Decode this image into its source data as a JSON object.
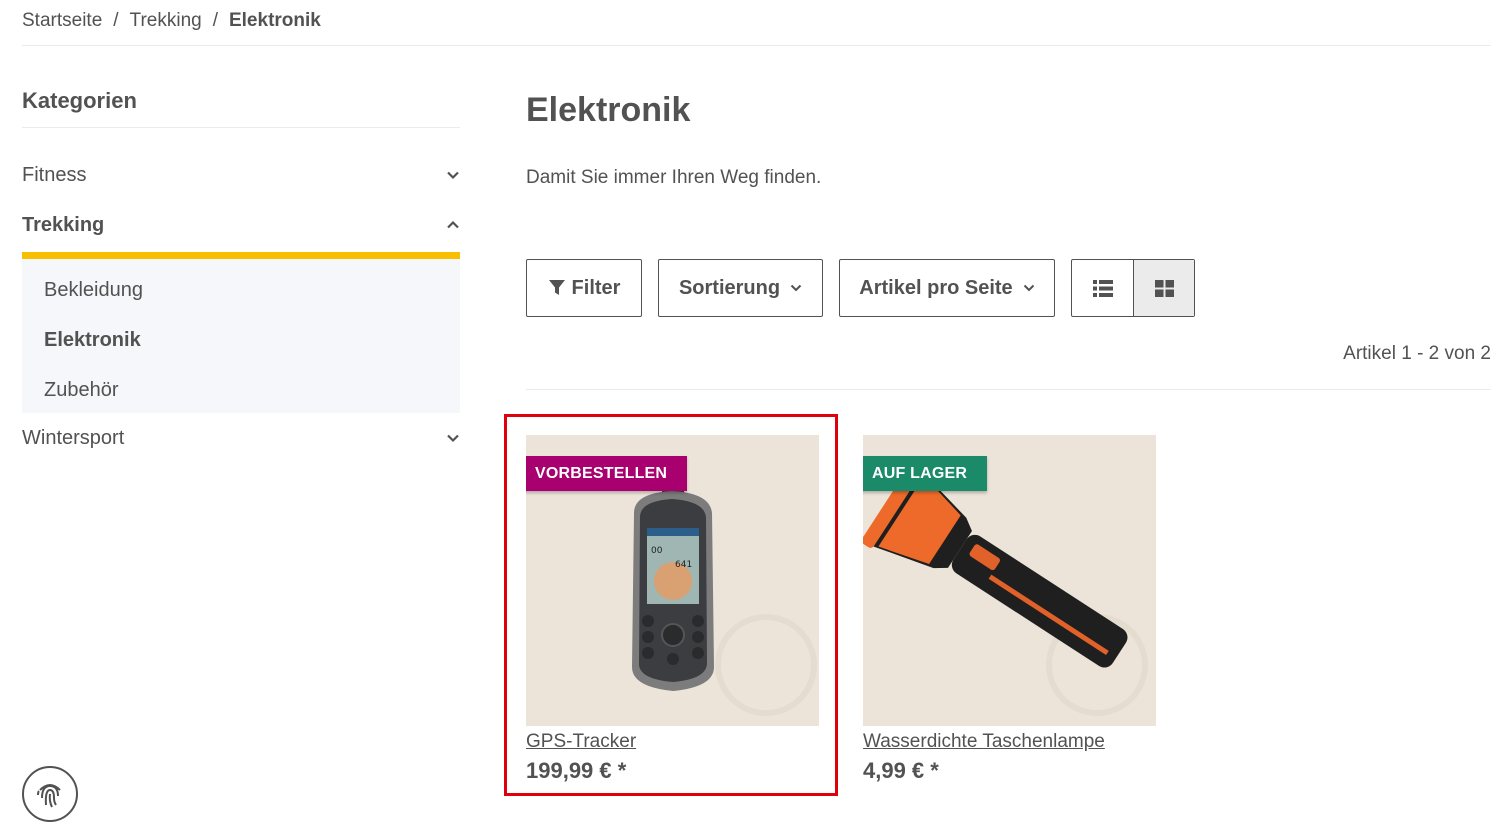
{
  "breadcrumb": {
    "items": [
      "Startseite",
      "Trekking",
      "Elektronik"
    ],
    "separator": "/"
  },
  "sidebar": {
    "title": "Kategorien",
    "categories": [
      {
        "label": "Fitness",
        "expanded": false
      },
      {
        "label": "Trekking",
        "expanded": true
      },
      {
        "label": "Wintersport",
        "expanded": false
      }
    ],
    "subcategories": [
      "Bekleidung",
      "Elektronik",
      "Zubehör"
    ],
    "active_subcategory": "Elektronik",
    "accent_color": "#f8bf00"
  },
  "main": {
    "title": "Elektronik",
    "description": "Damit Sie immer Ihren Weg finden.",
    "toolbar": {
      "filter_label": "Filter",
      "sort_label": "Sortierung",
      "perpage_label": "Artikel pro Seite",
      "view_modes": [
        "list",
        "grid"
      ],
      "active_view": "grid"
    },
    "count_text": "Artikel 1 - 2 von 2"
  },
  "products": [
    {
      "name": "GPS-Tracker",
      "price": "199,99 € *",
      "badge": "VORBESTELLEN",
      "badge_color": "#a8006f",
      "image": "gps-device"
    },
    {
      "name": "Wasserdichte Taschenlampe",
      "price": "4,99 € *",
      "badge": "AUF LAGER",
      "badge_color": "#1a8a68",
      "image": "flashlight"
    }
  ],
  "highlight_color": "#e0000b"
}
